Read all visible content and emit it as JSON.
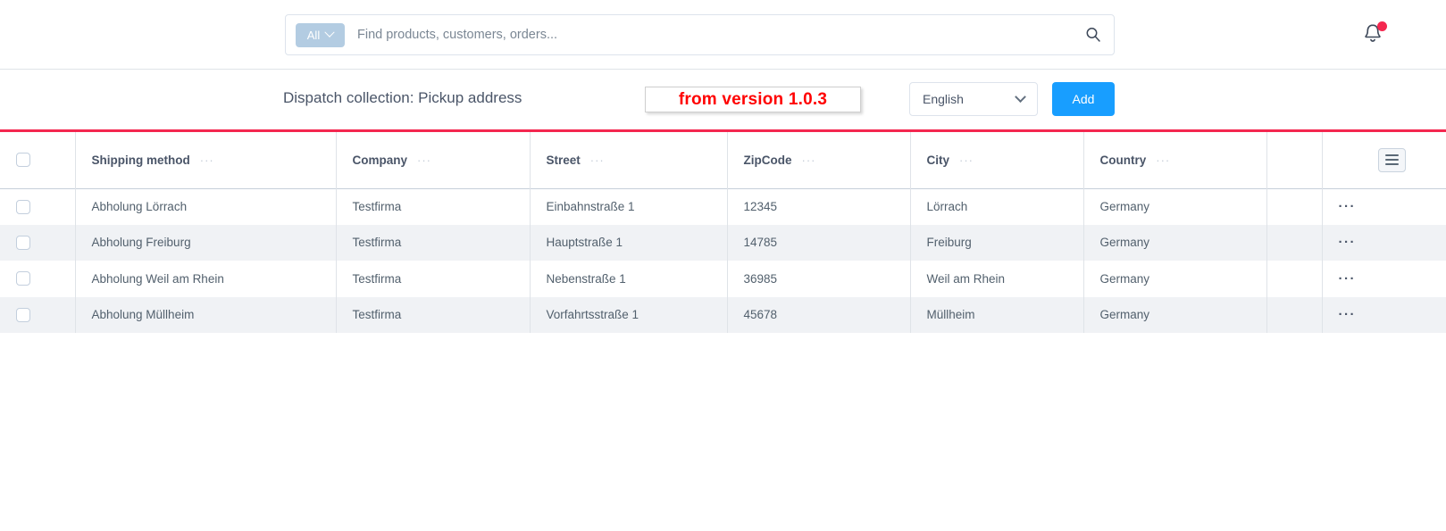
{
  "topbar": {
    "search": {
      "scope_label": "All",
      "scope_icon": "chevron-down-icon",
      "placeholder": "Find products, customers, orders...",
      "value": "",
      "icon": "search-icon"
    },
    "notifications": {
      "icon": "bell-icon",
      "has_unread": true,
      "badge_color": "#f4274f"
    }
  },
  "pagehead": {
    "title": "Dispatch collection: Pickup address",
    "annotation": "from version 1.0.3",
    "annotation_color": "#ff0000",
    "language": {
      "selected": "English",
      "icon": "chevron-down-icon"
    },
    "add_button": "Add",
    "add_button_color": "#189eff"
  },
  "table": {
    "accent_color": "#f4274f",
    "columns": [
      {
        "key": "shipping_method",
        "label": "Shipping method"
      },
      {
        "key": "company",
        "label": "Company"
      },
      {
        "key": "street",
        "label": "Street"
      },
      {
        "key": "zipcode",
        "label": "ZipCode"
      },
      {
        "key": "city",
        "label": "City"
      },
      {
        "key": "country",
        "label": "Country"
      }
    ],
    "column_menu_glyph": "···",
    "header_settings_icon": "hamburger-icon",
    "row_actions_glyph": "···",
    "rows": [
      {
        "shipping_method": "Abholung Lörrach",
        "company": "Testfirma",
        "street": "Einbahnstraße 1",
        "zipcode": "12345",
        "city": "Lörrach",
        "country": "Germany",
        "selected": false
      },
      {
        "shipping_method": "Abholung Freiburg",
        "company": "Testfirma",
        "street": "Hauptstraße 1",
        "zipcode": "14785",
        "city": "Freiburg",
        "country": "Germany",
        "selected": false
      },
      {
        "shipping_method": "Abholung Weil am Rhein",
        "company": "Testfirma",
        "street": "Nebenstraße 1",
        "zipcode": "36985",
        "city": "Weil am Rhein",
        "country": "Germany",
        "selected": false
      },
      {
        "shipping_method": "Abholung Müllheim",
        "company": "Testfirma",
        "street": "Vorfahrtsstraße 1",
        "zipcode": "45678",
        "city": "Müllheim",
        "country": "Germany",
        "selected": false
      }
    ]
  }
}
